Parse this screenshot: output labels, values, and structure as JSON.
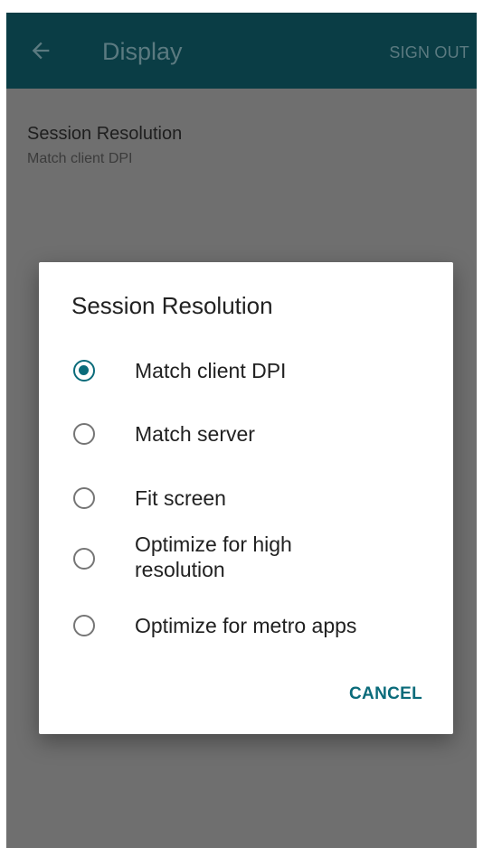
{
  "appbar": {
    "title": "Display",
    "sign_out_label": "SIGN OUT",
    "back_icon": "arrow-back-icon"
  },
  "preference": {
    "title": "Session Resolution",
    "summary": "Match client DPI"
  },
  "dialog": {
    "title": "Session Resolution",
    "options": [
      {
        "label": "Match client DPI",
        "selected": true
      },
      {
        "label": "Match server",
        "selected": false
      },
      {
        "label": "Fit screen",
        "selected": false
      },
      {
        "label": "Optimize for high resolution",
        "selected": false
      },
      {
        "label": "Optimize for metro apps",
        "selected": false
      }
    ],
    "cancel_label": "CANCEL"
  },
  "colors": {
    "appbar_bg": "#0a3d45",
    "accent": "#0a6b7a",
    "scrim_bg": "#6f6f6f"
  }
}
